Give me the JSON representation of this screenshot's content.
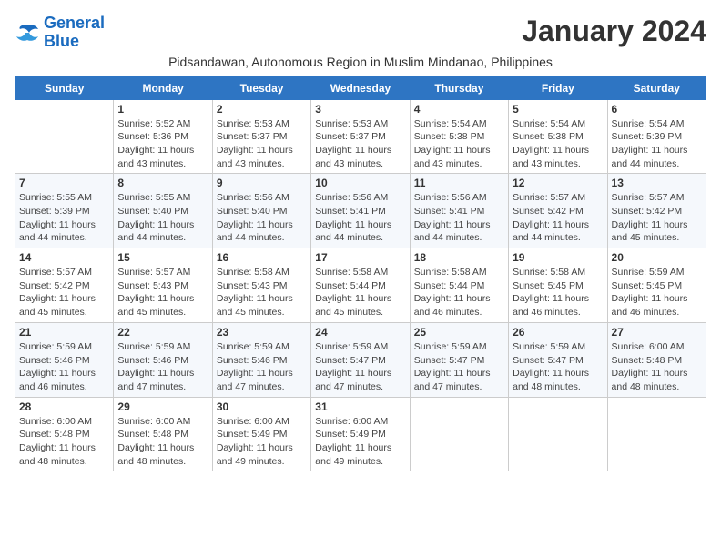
{
  "logo": {
    "line1": "General",
    "line2": "Blue"
  },
  "title": "January 2024",
  "subtitle": "Pidsandawan, Autonomous Region in Muslim Mindanao, Philippines",
  "days_header": [
    "Sunday",
    "Monday",
    "Tuesday",
    "Wednesday",
    "Thursday",
    "Friday",
    "Saturday"
  ],
  "weeks": [
    [
      {
        "day": "",
        "sunrise": "",
        "sunset": "",
        "daylight": ""
      },
      {
        "day": "1",
        "sunrise": "Sunrise: 5:52 AM",
        "sunset": "Sunset: 5:36 PM",
        "daylight": "Daylight: 11 hours and 43 minutes."
      },
      {
        "day": "2",
        "sunrise": "Sunrise: 5:53 AM",
        "sunset": "Sunset: 5:37 PM",
        "daylight": "Daylight: 11 hours and 43 minutes."
      },
      {
        "day": "3",
        "sunrise": "Sunrise: 5:53 AM",
        "sunset": "Sunset: 5:37 PM",
        "daylight": "Daylight: 11 hours and 43 minutes."
      },
      {
        "day": "4",
        "sunrise": "Sunrise: 5:54 AM",
        "sunset": "Sunset: 5:38 PM",
        "daylight": "Daylight: 11 hours and 43 minutes."
      },
      {
        "day": "5",
        "sunrise": "Sunrise: 5:54 AM",
        "sunset": "Sunset: 5:38 PM",
        "daylight": "Daylight: 11 hours and 43 minutes."
      },
      {
        "day": "6",
        "sunrise": "Sunrise: 5:54 AM",
        "sunset": "Sunset: 5:39 PM",
        "daylight": "Daylight: 11 hours and 44 minutes."
      }
    ],
    [
      {
        "day": "7",
        "sunrise": "Sunrise: 5:55 AM",
        "sunset": "Sunset: 5:39 PM",
        "daylight": "Daylight: 11 hours and 44 minutes."
      },
      {
        "day": "8",
        "sunrise": "Sunrise: 5:55 AM",
        "sunset": "Sunset: 5:40 PM",
        "daylight": "Daylight: 11 hours and 44 minutes."
      },
      {
        "day": "9",
        "sunrise": "Sunrise: 5:56 AM",
        "sunset": "Sunset: 5:40 PM",
        "daylight": "Daylight: 11 hours and 44 minutes."
      },
      {
        "day": "10",
        "sunrise": "Sunrise: 5:56 AM",
        "sunset": "Sunset: 5:41 PM",
        "daylight": "Daylight: 11 hours and 44 minutes."
      },
      {
        "day": "11",
        "sunrise": "Sunrise: 5:56 AM",
        "sunset": "Sunset: 5:41 PM",
        "daylight": "Daylight: 11 hours and 44 minutes."
      },
      {
        "day": "12",
        "sunrise": "Sunrise: 5:57 AM",
        "sunset": "Sunset: 5:42 PM",
        "daylight": "Daylight: 11 hours and 44 minutes."
      },
      {
        "day": "13",
        "sunrise": "Sunrise: 5:57 AM",
        "sunset": "Sunset: 5:42 PM",
        "daylight": "Daylight: 11 hours and 45 minutes."
      }
    ],
    [
      {
        "day": "14",
        "sunrise": "Sunrise: 5:57 AM",
        "sunset": "Sunset: 5:42 PM",
        "daylight": "Daylight: 11 hours and 45 minutes."
      },
      {
        "day": "15",
        "sunrise": "Sunrise: 5:57 AM",
        "sunset": "Sunset: 5:43 PM",
        "daylight": "Daylight: 11 hours and 45 minutes."
      },
      {
        "day": "16",
        "sunrise": "Sunrise: 5:58 AM",
        "sunset": "Sunset: 5:43 PM",
        "daylight": "Daylight: 11 hours and 45 minutes."
      },
      {
        "day": "17",
        "sunrise": "Sunrise: 5:58 AM",
        "sunset": "Sunset: 5:44 PM",
        "daylight": "Daylight: 11 hours and 45 minutes."
      },
      {
        "day": "18",
        "sunrise": "Sunrise: 5:58 AM",
        "sunset": "Sunset: 5:44 PM",
        "daylight": "Daylight: 11 hours and 46 minutes."
      },
      {
        "day": "19",
        "sunrise": "Sunrise: 5:58 AM",
        "sunset": "Sunset: 5:45 PM",
        "daylight": "Daylight: 11 hours and 46 minutes."
      },
      {
        "day": "20",
        "sunrise": "Sunrise: 5:59 AM",
        "sunset": "Sunset: 5:45 PM",
        "daylight": "Daylight: 11 hours and 46 minutes."
      }
    ],
    [
      {
        "day": "21",
        "sunrise": "Sunrise: 5:59 AM",
        "sunset": "Sunset: 5:46 PM",
        "daylight": "Daylight: 11 hours and 46 minutes."
      },
      {
        "day": "22",
        "sunrise": "Sunrise: 5:59 AM",
        "sunset": "Sunset: 5:46 PM",
        "daylight": "Daylight: 11 hours and 47 minutes."
      },
      {
        "day": "23",
        "sunrise": "Sunrise: 5:59 AM",
        "sunset": "Sunset: 5:46 PM",
        "daylight": "Daylight: 11 hours and 47 minutes."
      },
      {
        "day": "24",
        "sunrise": "Sunrise: 5:59 AM",
        "sunset": "Sunset: 5:47 PM",
        "daylight": "Daylight: 11 hours and 47 minutes."
      },
      {
        "day": "25",
        "sunrise": "Sunrise: 5:59 AM",
        "sunset": "Sunset: 5:47 PM",
        "daylight": "Daylight: 11 hours and 47 minutes."
      },
      {
        "day": "26",
        "sunrise": "Sunrise: 5:59 AM",
        "sunset": "Sunset: 5:47 PM",
        "daylight": "Daylight: 11 hours and 48 minutes."
      },
      {
        "day": "27",
        "sunrise": "Sunrise: 6:00 AM",
        "sunset": "Sunset: 5:48 PM",
        "daylight": "Daylight: 11 hours and 48 minutes."
      }
    ],
    [
      {
        "day": "28",
        "sunrise": "Sunrise: 6:00 AM",
        "sunset": "Sunset: 5:48 PM",
        "daylight": "Daylight: 11 hours and 48 minutes."
      },
      {
        "day": "29",
        "sunrise": "Sunrise: 6:00 AM",
        "sunset": "Sunset: 5:48 PM",
        "daylight": "Daylight: 11 hours and 48 minutes."
      },
      {
        "day": "30",
        "sunrise": "Sunrise: 6:00 AM",
        "sunset": "Sunset: 5:49 PM",
        "daylight": "Daylight: 11 hours and 49 minutes."
      },
      {
        "day": "31",
        "sunrise": "Sunrise: 6:00 AM",
        "sunset": "Sunset: 5:49 PM",
        "daylight": "Daylight: 11 hours and 49 minutes."
      },
      {
        "day": "",
        "sunrise": "",
        "sunset": "",
        "daylight": ""
      },
      {
        "day": "",
        "sunrise": "",
        "sunset": "",
        "daylight": ""
      },
      {
        "day": "",
        "sunrise": "",
        "sunset": "",
        "daylight": ""
      }
    ]
  ]
}
